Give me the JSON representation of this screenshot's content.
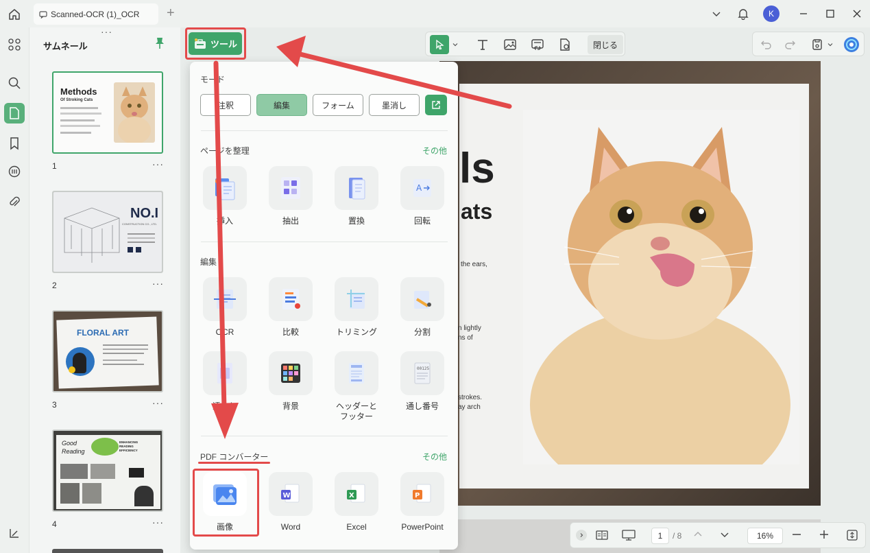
{
  "window": {
    "tab_title": "Scanned-OCR (1)_OCR",
    "avatar_initial": "K"
  },
  "thumbnails": {
    "title": "サムネール",
    "pages": [
      {
        "number": "1",
        "title": "Methods",
        "subtitle": "Of Stroking Cats"
      },
      {
        "number": "2",
        "title": "NO.I",
        "subtitle": "CONSTRUCTION CO., LTD."
      },
      {
        "number": "3",
        "title": "FLORAL ART",
        "subtitle": ""
      },
      {
        "number": "4",
        "title": "Good Reading",
        "subtitle": "ENHANCING READING EFFICIENCY"
      }
    ]
  },
  "toolbar": {
    "tools_label": "ツール",
    "close_label": "閉じる"
  },
  "popup": {
    "mode_label": "モード",
    "modes": [
      "注釈",
      "編集",
      "フォーム",
      "墨消し"
    ],
    "active_mode": "編集",
    "organize_label": "ページを整理",
    "organize_more": "その他",
    "organize_items": [
      "挿入",
      "抽出",
      "置換",
      "回転"
    ],
    "edit_label": "編集",
    "edit_items": [
      "OCR",
      "比較",
      "トリミング",
      "分割",
      "透かし",
      "背景",
      "ヘッダーと\nフッター",
      "通し番号"
    ],
    "converter_label": "PDF コンバーター",
    "converter_more": "その他",
    "converter_items": [
      "画像",
      "Word",
      "Excel",
      "PowerPoint"
    ]
  },
  "document": {
    "title_fragment": "ls",
    "subtitle_fragment": "ats",
    "text_fragments": [
      "the ears,",
      "n lightly",
      "ns of",
      "strokes.",
      "ay arch"
    ]
  },
  "bottom_bar": {
    "page_current": "1",
    "page_total": "/ 8",
    "zoom": "16%"
  },
  "colors": {
    "accent": "#3fa56a",
    "highlight": "#e34a4a"
  }
}
